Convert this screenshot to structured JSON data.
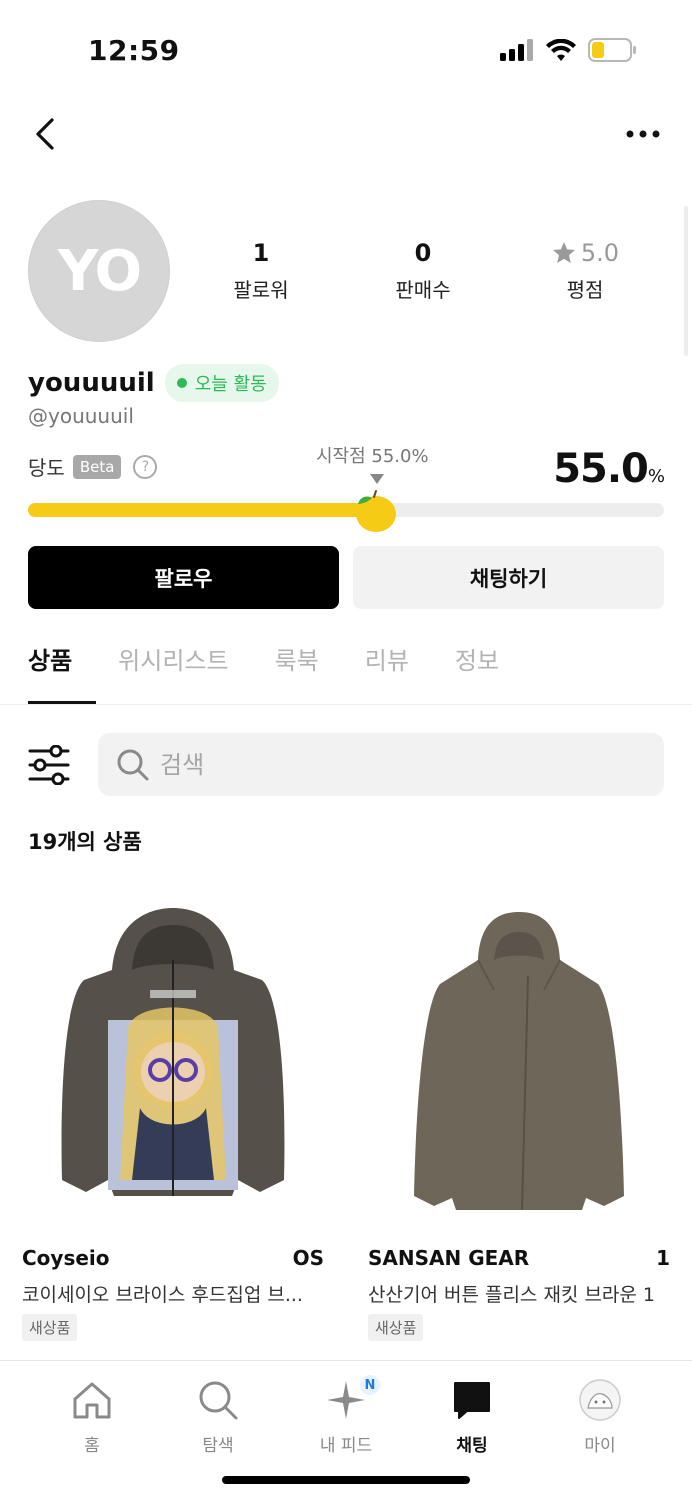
{
  "status": {
    "time": "12:59"
  },
  "profile": {
    "avatar_initials": "YO",
    "stats": [
      {
        "value": "1",
        "label": "팔로워"
      },
      {
        "value": "0",
        "label": "판매수"
      },
      {
        "value": "5.0",
        "label": "평점"
      }
    ],
    "username": "youuuuil",
    "active_badge": "오늘 활동",
    "handle": "@youuuuil"
  },
  "sweetness": {
    "label": "당도",
    "beta": "Beta",
    "start_label": "시작점 55.0%",
    "value": "55.0",
    "unit": "%",
    "level": 0.55
  },
  "buttons": {
    "follow": "팔로우",
    "chat": "채팅하기"
  },
  "tabs": [
    "상품",
    "위시리스트",
    "룩북",
    "리뷰",
    "정보"
  ],
  "search": {
    "placeholder": "검색"
  },
  "product_count": {
    "number": "19",
    "suffix": "개의 상품"
  },
  "products": [
    {
      "brand": "Coyseio",
      "size": "OS",
      "name": "코이세이오 브라이스 후드집업 브...",
      "tag": "새상품"
    },
    {
      "brand": "SANSAN GEAR",
      "size": "1",
      "name": "산산기어 버튼 플리스 재킷 브라운 1",
      "tag": "새상품"
    }
  ],
  "tabbar": [
    {
      "label": "홈",
      "icon": "home-icon"
    },
    {
      "label": "탐색",
      "icon": "search-icon"
    },
    {
      "label": "내 피드",
      "icon": "sparkle-icon",
      "badge": "N"
    },
    {
      "label": "채팅",
      "icon": "chat-icon",
      "active": true
    },
    {
      "label": "마이",
      "icon": "profile-icon"
    }
  ],
  "colors": {
    "accent_yellow": "#f6cb16",
    "active_green": "#2dbb55",
    "badge_blue": "#1f7ae0"
  }
}
